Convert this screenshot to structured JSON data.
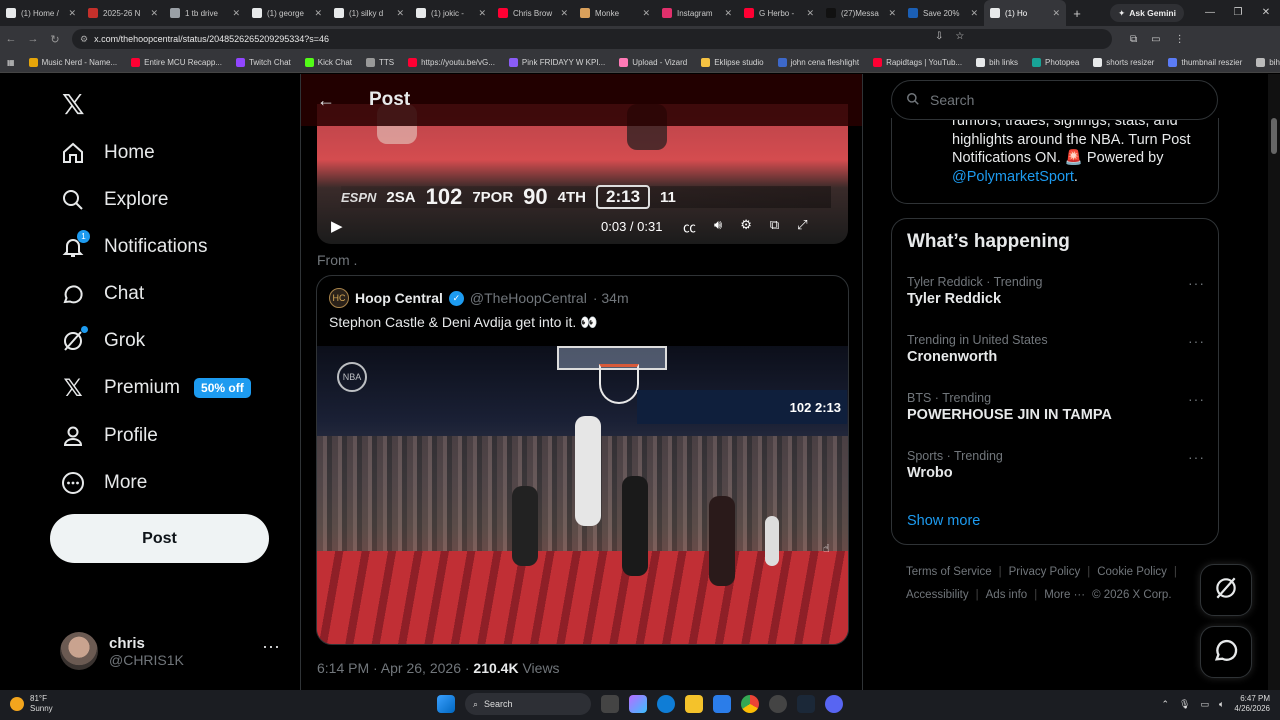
{
  "browser": {
    "tabs": [
      {
        "label": "(1) Home /",
        "color": "#e7e9ea"
      },
      {
        "label": "2025-26 N",
        "color": "#c4302b"
      },
      {
        "label": "1 tb drive",
        "color": "#9aa0a6"
      },
      {
        "label": "(1) george",
        "color": "#e7e9ea"
      },
      {
        "label": "(1) silky d",
        "color": "#e7e9ea"
      },
      {
        "label": "(1) jokic -",
        "color": "#e7e9ea"
      },
      {
        "label": "Chris Brow",
        "color": "#ff0033"
      },
      {
        "label": "Monke",
        "color": "#d9a05b"
      },
      {
        "label": "Instagram",
        "color": "#e1306c"
      },
      {
        "label": "G Herbo -",
        "color": "#ff0033"
      },
      {
        "label": "(27)Messa",
        "color": "#111111"
      },
      {
        "label": "Save 20%",
        "color": "#1b5fb5"
      },
      {
        "label": "(1) Ho",
        "color": "#e7e9ea"
      }
    ],
    "new_tab": "+",
    "ask_gemini": "Ask Gemini",
    "url": "x.com/thehoopcentral/status/2048526265209295334?s=46",
    "bookmarks": [
      {
        "label": "Music Nerd - Name...",
        "color": "#e5a50a"
      },
      {
        "label": "Entire MCU Recapp...",
        "color": "#ff0033"
      },
      {
        "label": "Twitch Chat",
        "color": "#9146ff"
      },
      {
        "label": "Kick Chat",
        "color": "#53fc18"
      },
      {
        "label": "TTS",
        "color": "#999999"
      },
      {
        "label": "https://youtu.be/vG...",
        "color": "#ff0033"
      },
      {
        "label": "Pink FRIDAYY W KPI...",
        "color": "#8a5cf6"
      },
      {
        "label": "Upload - Vizard",
        "color": "#ff7ab6"
      },
      {
        "label": "Eklipse studio",
        "color": "#f5c242"
      },
      {
        "label": "john cena fleshlight",
        "color": "#3d68c9"
      },
      {
        "label": "Rapidtags | YouTub...",
        "color": "#ff0033"
      },
      {
        "label": "bih links",
        "color": "#e7e9ea"
      },
      {
        "label": "Photopea",
        "color": "#18a497"
      },
      {
        "label": "shorts resizer",
        "color": "#e7e9ea"
      },
      {
        "label": "thumbnail reszier",
        "color": "#5b7cf6"
      },
      {
        "label": "bih streams",
        "color": "#bbbbbb"
      }
    ]
  },
  "nav": {
    "items": [
      {
        "label": "Home"
      },
      {
        "label": "Explore"
      },
      {
        "label": "Notifications",
        "badge": "1"
      },
      {
        "label": "Chat"
      },
      {
        "label": "Grok"
      },
      {
        "label": "Premium",
        "pill": "50% off"
      },
      {
        "label": "Profile"
      },
      {
        "label": "More"
      }
    ],
    "post_button": "Post",
    "account": {
      "name": "chris",
      "handle": "@CHRIS1K",
      "more": "···"
    }
  },
  "header": {
    "title": "Post",
    "back": "←"
  },
  "video1": {
    "network": "ESPN",
    "team1": "2SA",
    "score1": "102",
    "team2": "7POR",
    "score2": "90",
    "quarter": "4TH",
    "clock": "2:13",
    "shot": "11",
    "time": "0:03 / 0:31"
  },
  "from_text": "From .",
  "quote": {
    "name": "Hoop Central",
    "handle": "@TheHoopCentral",
    "age": "· 34m",
    "text": "Stephon Castle & Deni Avdija get into it. 👀",
    "scoreboard": "102  2:13"
  },
  "meta": {
    "time": "6:14 PM · Apr 26, 2026 · ",
    "views": "210.4K",
    "views_label": " Views"
  },
  "sidebar": {
    "search_placeholder": "Search",
    "bio_text": "rumors, trades, signings, stats, and highlights around the NBA. Turn Post Notifications ON. 🚨 Powered by ",
    "bio_link": "@PolymarketSport",
    "bio_end": ".",
    "whats_happening": "What’s happening",
    "trends": [
      {
        "context": "Tyler Reddick · Trending",
        "title": "Tyler Reddick"
      },
      {
        "context": "Trending in United States",
        "title": "Cronenworth"
      },
      {
        "context": "BTS · Trending",
        "title": "POWERHOUSE JIN IN TAMPA"
      },
      {
        "context": "Sports · Trending",
        "title": "Wrobo"
      }
    ],
    "show_more": "Show more",
    "footer": [
      "Terms of Service",
      "Privacy Policy",
      "Cookie Policy",
      "Accessibility",
      "Ads info",
      "More ···",
      "© 2026 X Corp."
    ]
  },
  "taskbar": {
    "temp": "81°F",
    "condition": "Sunny",
    "search": "Search",
    "time": "6:47 PM",
    "date": "4/26/2026"
  },
  "colors": {
    "accent": "#1d9bf0",
    "bg": "#000000",
    "border": "#2f3336",
    "muted": "#71767b"
  }
}
